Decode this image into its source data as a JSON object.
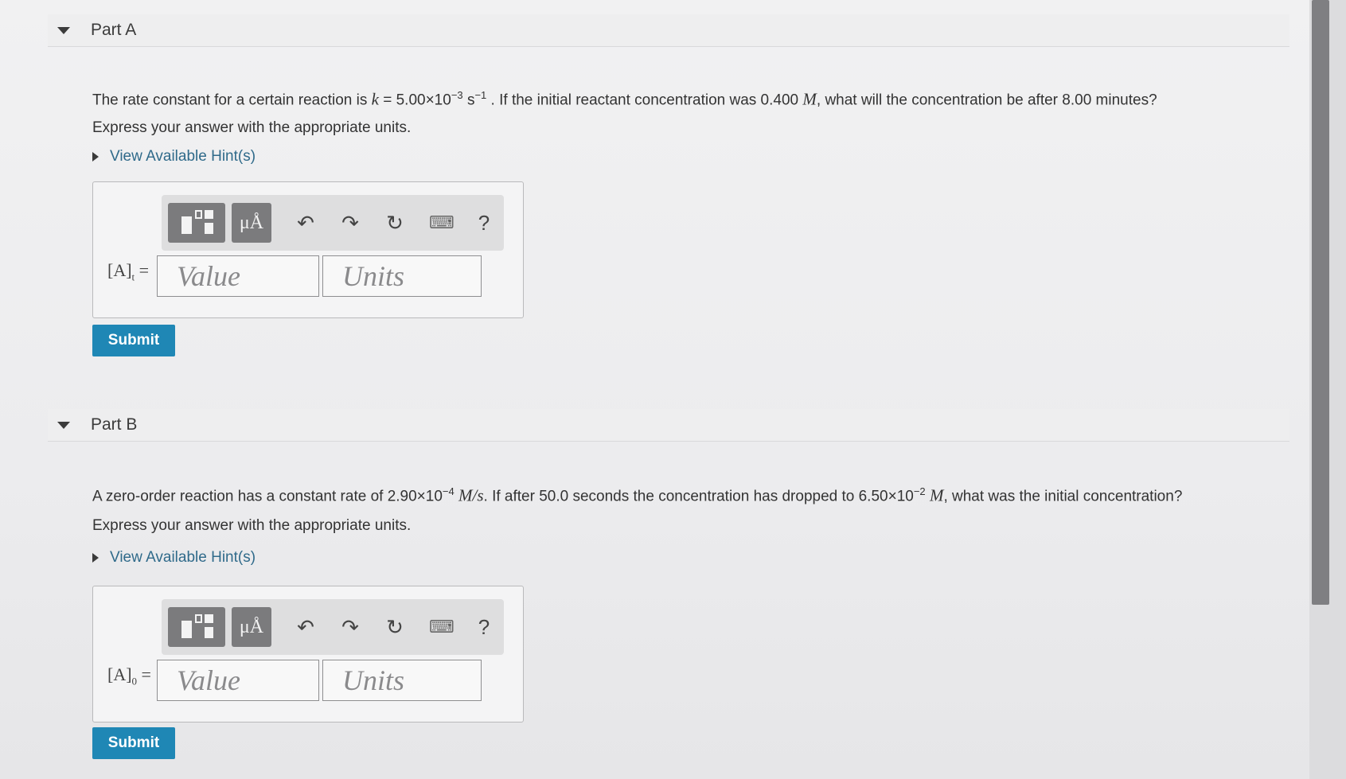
{
  "partA": {
    "title": "Part A",
    "question_pre": "The rate constant for a certain reaction is",
    "k_symbol": "k",
    "k_value": "= 5.00×10",
    "k_exp": "−3",
    "k_unit": "s",
    "k_unit_exp": "−1",
    "question_post": ". If the initial reactant concentration was 0.400",
    "conc_unit": "M",
    "question_end": ", what will the concentration be after 8.00 minutes?",
    "instruction": "Express your answer with the appropriate units.",
    "hint": "View Available Hint(s)",
    "eq_label": "[A]",
    "eq_sub": "t",
    "eq_equals": "=",
    "value_placeholder": "Value",
    "units_placeholder": "Units",
    "submit": "Submit"
  },
  "partB": {
    "title": "Part B",
    "question_pre": "A zero-order reaction has a constant rate of 2.90×10",
    "rate_exp": "−4",
    "rate_unit": "M/s",
    "question_mid": ". If after 50.0 seconds the concentration has dropped to 6.50×10",
    "conc_exp": "−2",
    "conc_unit": "M",
    "question_end": ", what was the initial concentration?",
    "instruction": "Express your answer with the appropriate units.",
    "hint": "View Available Hint(s)",
    "eq_label": "[A]",
    "eq_sub": "0",
    "eq_equals": "=",
    "value_placeholder": "Value",
    "units_placeholder": "Units",
    "submit": "Submit"
  },
  "toolbar": {
    "mu_label": "μÅ",
    "help_label": "?",
    "icons": [
      "templates-icon",
      "units-symbol-icon",
      "undo-icon",
      "redo-icon",
      "reset-icon",
      "keyboard-icon",
      "help-icon"
    ]
  }
}
